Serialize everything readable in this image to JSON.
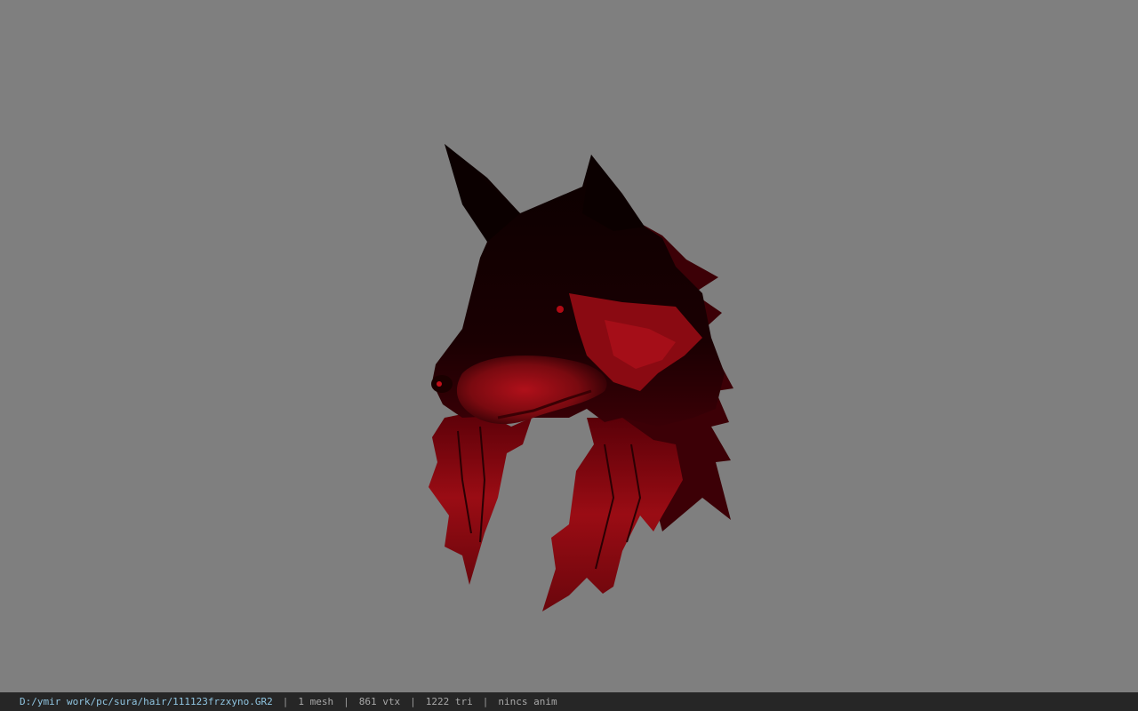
{
  "viewport": {
    "background_color": "#7f7f7f",
    "model_name": "wolf-head-hair-mesh"
  },
  "status": {
    "file_path": "D:/ymir work/pc/sura/hair/111123frzxyno.GR2",
    "separator": "|",
    "mesh_count": "1 mesh",
    "vertex_count": "861 vtx",
    "triangle_count": "1222 tri",
    "anim_status": "nincs anim"
  }
}
